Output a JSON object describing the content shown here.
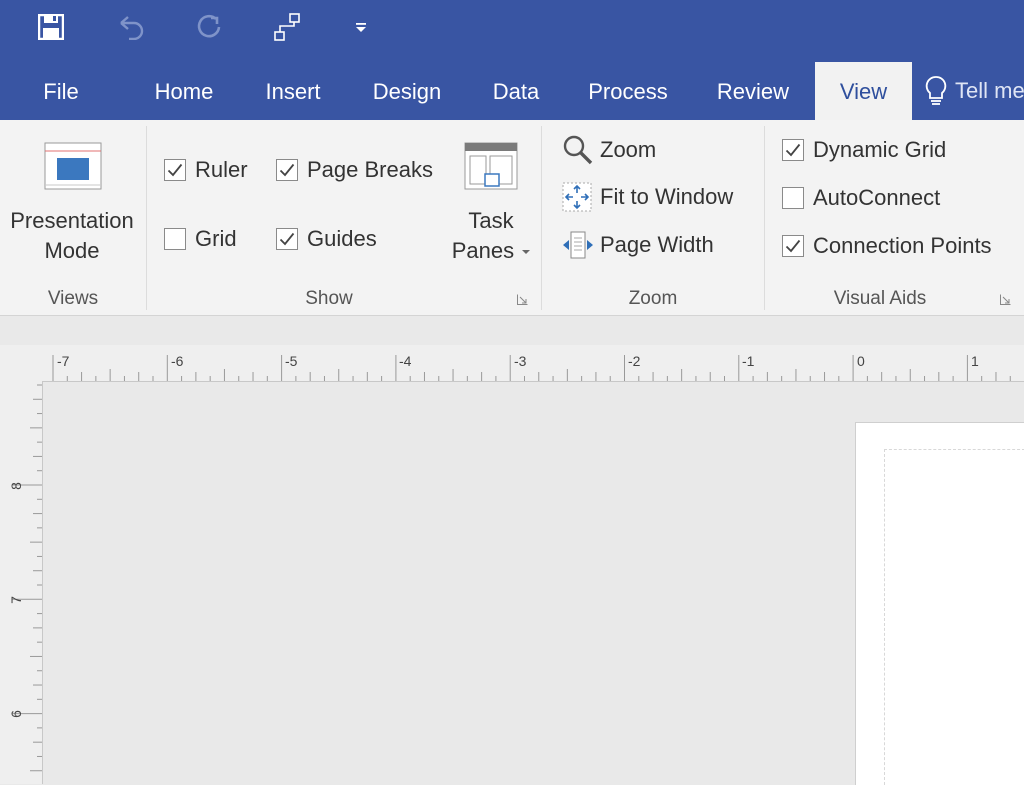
{
  "quick_access": {
    "save": "save-icon",
    "undo": "undo-icon",
    "redo": "redo-icon",
    "connector": "connector-icon",
    "customize": "customize-qat-icon"
  },
  "tabs": [
    {
      "label": "File"
    },
    {
      "label": "Home"
    },
    {
      "label": "Insert"
    },
    {
      "label": "Design"
    },
    {
      "label": "Data"
    },
    {
      "label": "Process"
    },
    {
      "label": "Review"
    },
    {
      "label": "View",
      "active": true
    }
  ],
  "tell_me": "Tell me",
  "groups": {
    "views": {
      "label": "Views",
      "presentation_line1": "Presentation",
      "presentation_line2": "Mode"
    },
    "show": {
      "label": "Show",
      "ruler": {
        "label": "Ruler",
        "checked": true
      },
      "page_breaks": {
        "label": "Page Breaks",
        "checked": true
      },
      "grid": {
        "label": "Grid",
        "checked": false
      },
      "guides": {
        "label": "Guides",
        "checked": true
      },
      "task_line1": "Task",
      "task_line2": "Panes"
    },
    "zoom": {
      "label": "Zoom",
      "zoom": "Zoom",
      "fit": "Fit to Window",
      "width": "Page Width"
    },
    "visual_aids": {
      "label": "Visual Aids",
      "dynamic_grid": {
        "label": "Dynamic Grid",
        "checked": true
      },
      "autoconnect": {
        "label": "AutoConnect",
        "checked": false
      },
      "connection_points": {
        "label": "Connection Points",
        "checked": true
      }
    }
  },
  "ruler": {
    "h": [
      "-7",
      "-6",
      "-5",
      "-4",
      "-3",
      "-2",
      "-1",
      "0",
      "1"
    ],
    "v": [
      "8",
      "7",
      "6"
    ]
  },
  "colors": {
    "accent": "#3955a3",
    "ribbon": "#f3f3f3",
    "canvas": "#e9e9e9"
  }
}
